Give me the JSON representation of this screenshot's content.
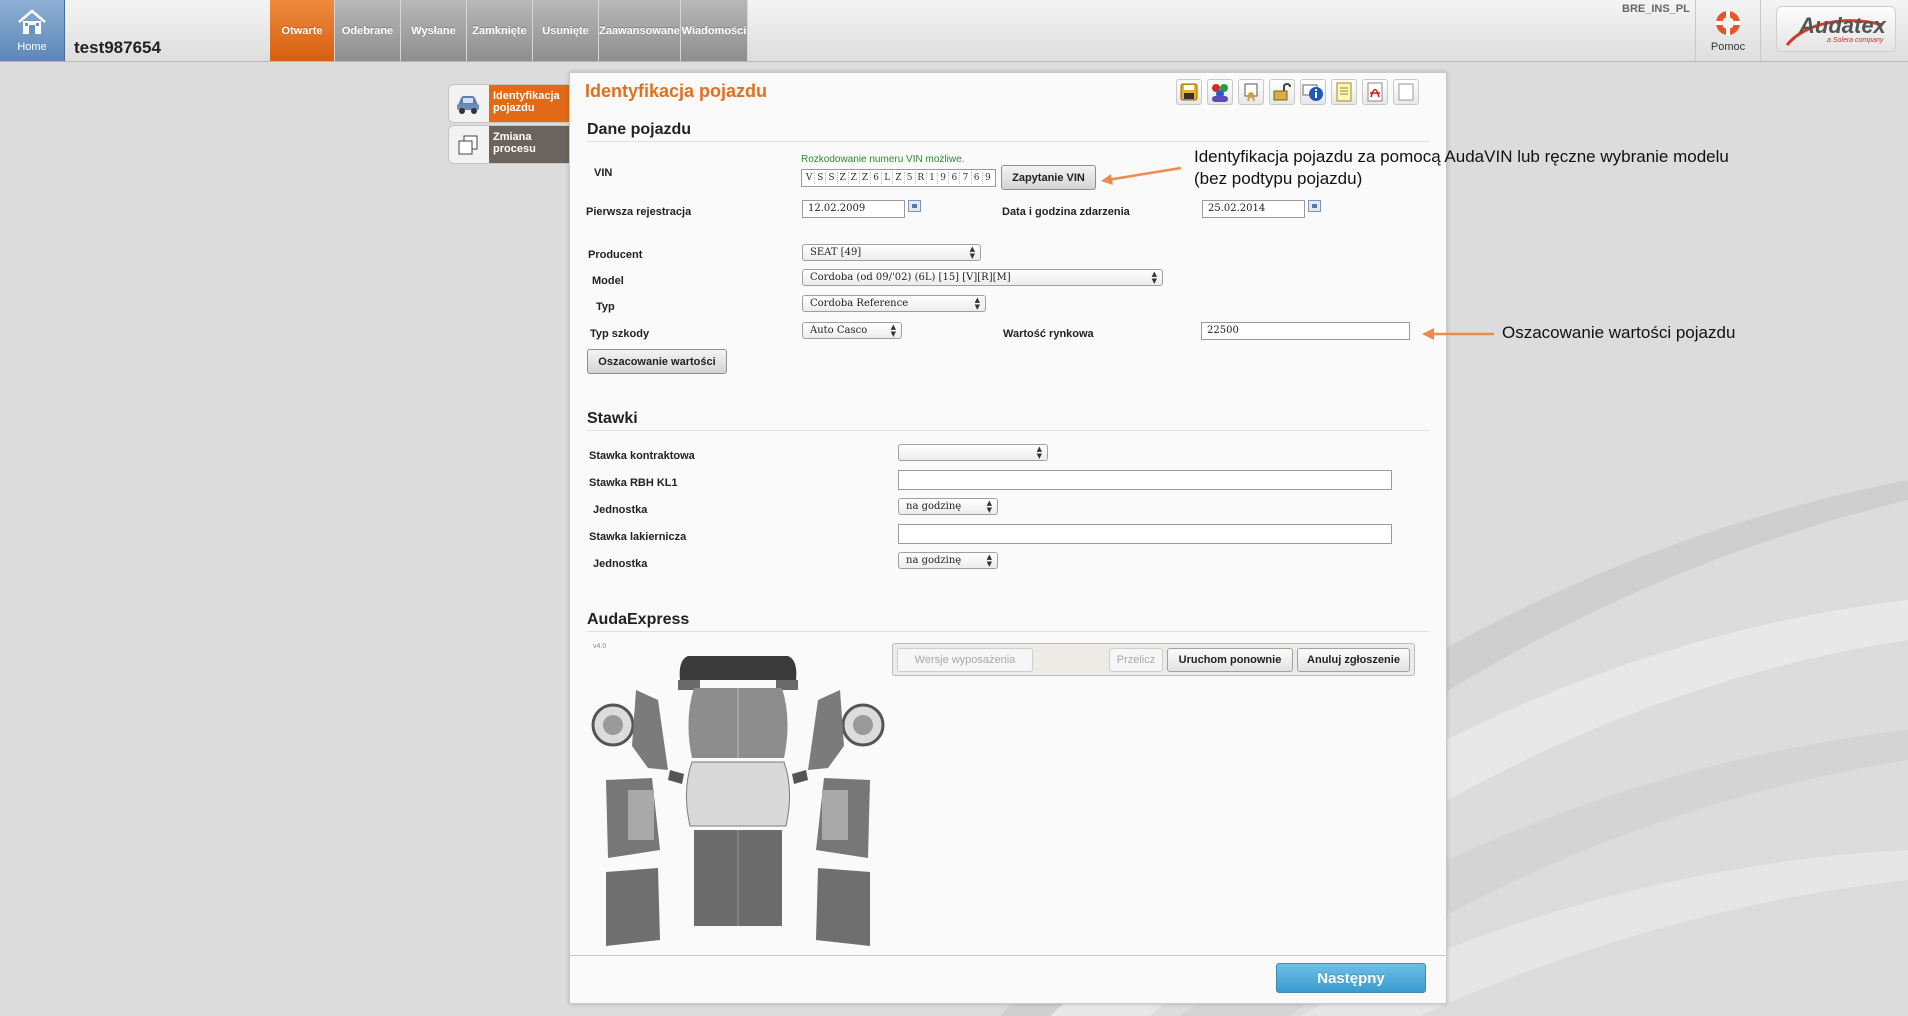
{
  "topbar": {
    "home_label": "Home",
    "user_name": "test987654",
    "tabs": [
      {
        "label": "Otwarte",
        "active": true
      },
      {
        "label": "Odebrane",
        "active": false
      },
      {
        "label": "Wysłane",
        "active": false
      },
      {
        "label": "Zamknięte",
        "active": false
      },
      {
        "label": "Usunięte",
        "active": false
      },
      {
        "label": "Zaawansowane",
        "active": false
      },
      {
        "label": "Wiadomości",
        "active": false
      }
    ],
    "env_code": "BRE_INS_PL",
    "help_label": "Pomoc",
    "logo_text": "Audatex",
    "logo_sub": "a Solera company"
  },
  "side_tabs": [
    {
      "label": "Identyfikacja pojazdu",
      "icon": "car-icon",
      "active": true
    },
    {
      "label": "Zmiana procesu",
      "icon": "copy-process-icon",
      "active": false
    }
  ],
  "panel": {
    "title": "Identyfikacja pojazdu",
    "toolbar_icons": [
      "save-icon",
      "users-icon",
      "certificate-icon",
      "unlock-icon",
      "info-icon",
      "notes-icon",
      "pdf-icon",
      "blank-page-icon"
    ]
  },
  "vehicle": {
    "section_title": "Dane pojazdu",
    "vin_label": "VIN",
    "vin_note": "Rozkodowanie numeru VIN możliwe.",
    "vin_chars": [
      "V",
      "S",
      "S",
      "Z",
      "Z",
      "Z",
      "6",
      "L",
      "Z",
      "5",
      "R",
      "1",
      "9",
      "6",
      "7",
      "6",
      "9"
    ],
    "vin_button": "Zapytanie VIN",
    "first_reg_label": "Pierwsza rejestracja",
    "first_reg_value": "12.02.2009",
    "event_date_label": "Data i godzina zdarzenia",
    "event_date_value": "25.02.2014",
    "producer_label": "Producent",
    "producer_value": "SEAT [49]",
    "model_label": "Model",
    "model_value": "Cordoba (od 09/'02) (6L) [15] [V][R][M]",
    "type_label": "Typ",
    "type_value": "Cordoba Reference",
    "damage_type_label": "Typ szkody",
    "damage_type_value": "Auto Casco",
    "market_value_label": "Wartość rynkowa",
    "market_value": "22500",
    "estimate_button": "Oszacowanie wartości"
  },
  "rates": {
    "section_title": "Stawki",
    "contract_rate_label": "Stawka kontraktowa",
    "contract_rate_value": "",
    "rbh_label": "Stawka RBH KL1",
    "rbh_value": "",
    "unit1_label": "Jednostka",
    "unit1_value": "na godzinę",
    "paint_rate_label": "Stawka lakiernicza",
    "paint_rate_value": "",
    "unit2_label": "Jednostka",
    "unit2_value": "na godzinę"
  },
  "audaexpress": {
    "section_title": "AudaExpress",
    "version": "v4.0",
    "equipment_button": "Wersje wyposażenia",
    "recalc_button": "Przelicz",
    "restart_button": "Uruchom ponownie",
    "cancel_button": "Anuluj zgłoszenie"
  },
  "footer": {
    "next_button": "Następny"
  },
  "annotations": {
    "vin_annotation_line1": "Identyfikacja pojazdu za pomocą AudaVIN lub ręczne wybranie modelu",
    "vin_annotation_line2": "(bez podtypu pojazdu)",
    "value_annotation": "Oszacowanie wartości pojazdu",
    "arrow_color": "#ee8a4e"
  },
  "colors": {
    "accent_orange": "#e16a17",
    "home_blue": "#6a90bf",
    "next_blue": "#45a3d6",
    "vin_note_green": "#2f8a2f"
  }
}
